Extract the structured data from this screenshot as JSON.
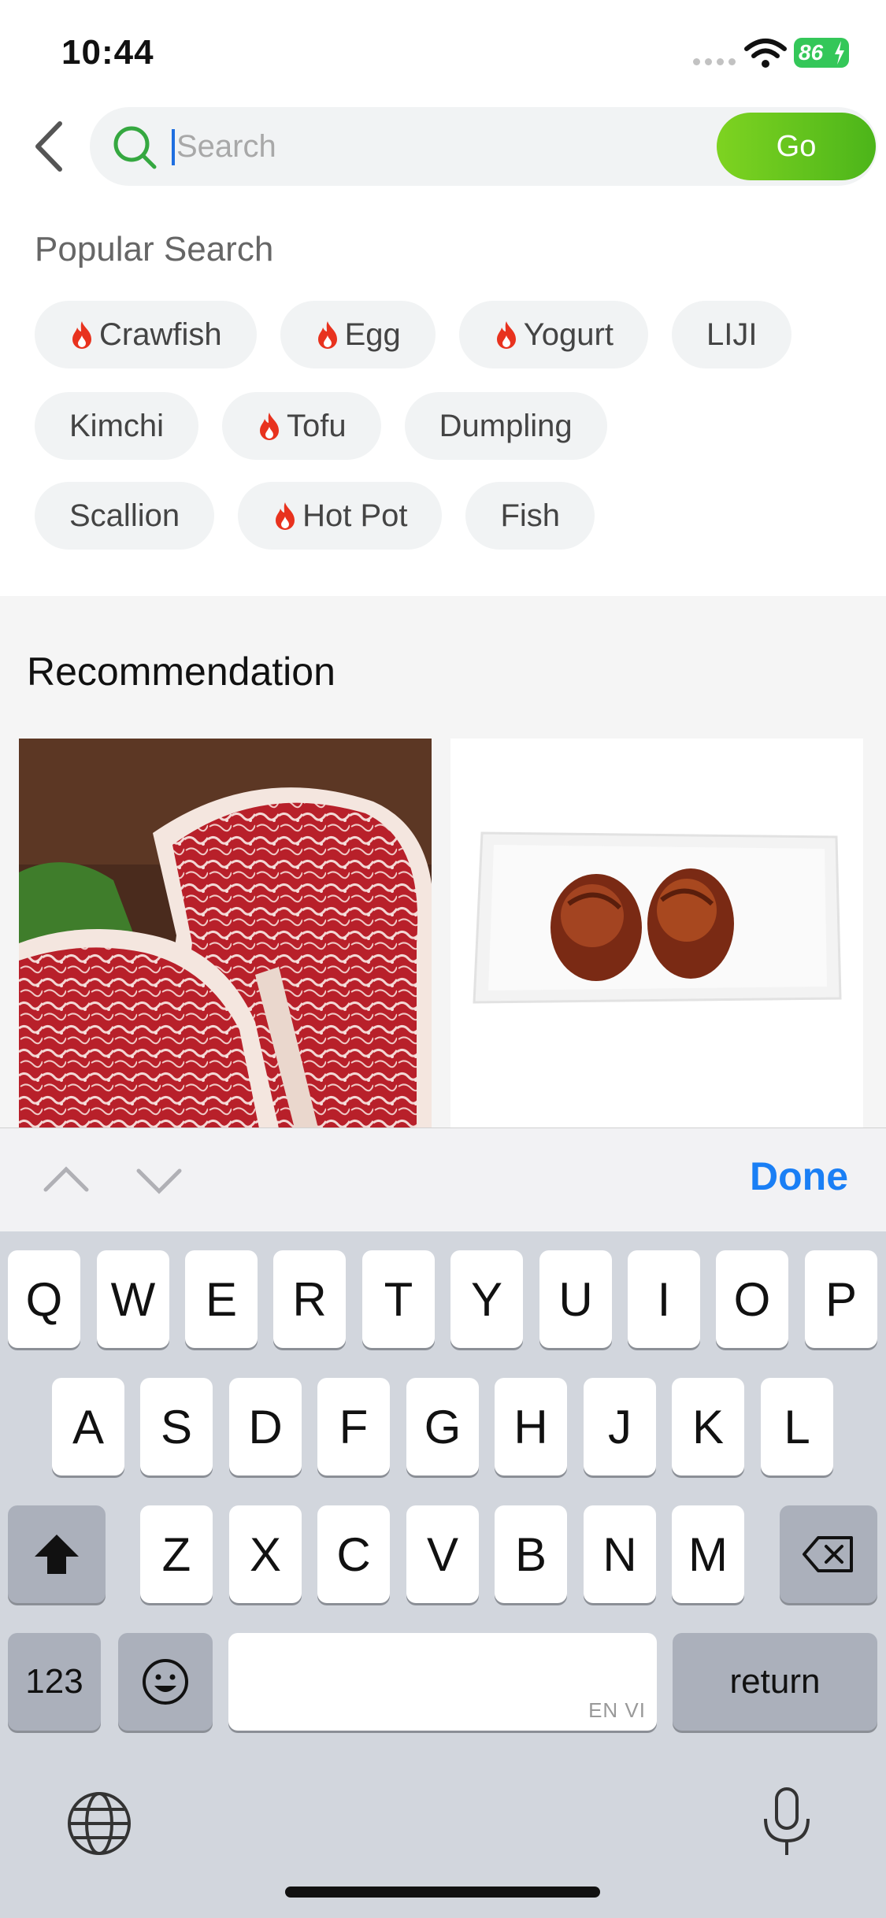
{
  "status_bar": {
    "time": "10:44",
    "battery": "86"
  },
  "search": {
    "placeholder": "Search",
    "go_label": "Go"
  },
  "popular": {
    "title": "Popular Search",
    "rows": [
      [
        {
          "label": "Crawfish",
          "hot": true
        },
        {
          "label": "Egg",
          "hot": true
        },
        {
          "label": "Yogurt",
          "hot": true
        },
        {
          "label": "LIJI",
          "hot": false
        }
      ],
      [
        {
          "label": "Kimchi",
          "hot": false
        },
        {
          "label": "Tofu",
          "hot": true
        },
        {
          "label": "Dumpling",
          "hot": false
        }
      ],
      [
        {
          "label": "Scallion",
          "hot": false
        },
        {
          "label": "Hot Pot",
          "hot": true
        },
        {
          "label": "Fish",
          "hot": false
        }
      ]
    ]
  },
  "recommendation": {
    "title": "Recommendation"
  },
  "accessory": {
    "done_label": "Done"
  },
  "keyboard": {
    "row1": [
      "Q",
      "W",
      "E",
      "R",
      "T",
      "Y",
      "U",
      "I",
      "O",
      "P"
    ],
    "row2": [
      "A",
      "S",
      "D",
      "F",
      "G",
      "H",
      "J",
      "K",
      "L"
    ],
    "row3": [
      "Z",
      "X",
      "C",
      "V",
      "B",
      "N",
      "M"
    ],
    "numbers_label": "123",
    "return_label": "return",
    "space_hint": "EN VI"
  },
  "colors": {
    "accent_green": "#4cb51a",
    "done_blue": "#1a7ff5",
    "hot_red": "#e8321e"
  }
}
